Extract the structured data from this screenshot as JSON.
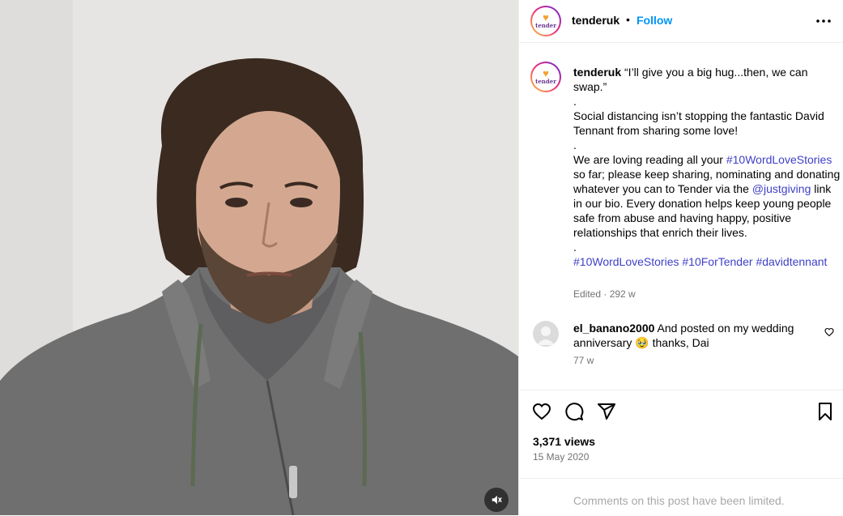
{
  "video": {
    "muted": true,
    "mute_icon": "speaker-muted-icon"
  },
  "header": {
    "avatar_brand": "tender",
    "username": "tenderuk",
    "separator": "•",
    "follow_label": "Follow",
    "more_icon": "more-options-icon"
  },
  "caption": {
    "username": "tenderuk",
    "text_1": "“I’ll give you a big hug...then, we can swap.”",
    "dot_1": ".",
    "text_2": "Social distancing isn’t stopping the fantastic David Tennant from sharing some love!",
    "dot_2": ".",
    "text_3a": "We are loving reading all your",
    "hashtag_1": "#10WordLoveStories",
    "text_3b": " so far; please keep sharing, nominating and donating whatever you can to Tender via the ",
    "mention": "@justgiving",
    "text_3c": " link in our bio. Every donation helps keep young people safe from abuse and having happy, positive relationships that enrich their lives.",
    "dot_3": ".",
    "hashtag_2": "#10WordLoveStories",
    "hashtag_3": "#10ForTender",
    "hashtag_4": "#davidtennant",
    "meta": "Edited · 292 w"
  },
  "comment": {
    "username": "el_banano2000",
    "text": " And posted on my wedding anniversary 🥹 thanks, Dai",
    "time": "77 w"
  },
  "actions": {
    "like_icon": "heart-icon",
    "comment_icon": "comment-icon",
    "share_icon": "share-icon",
    "save_icon": "bookmark-icon"
  },
  "stats": {
    "views": "3,371 views",
    "date": "15 May 2020"
  },
  "footer": {
    "limited_text": "Comments on this post have been limited."
  },
  "colors": {
    "link_blue": "#0095f6",
    "hashtag": "#3f3fc8",
    "muted_text": "#737373"
  }
}
